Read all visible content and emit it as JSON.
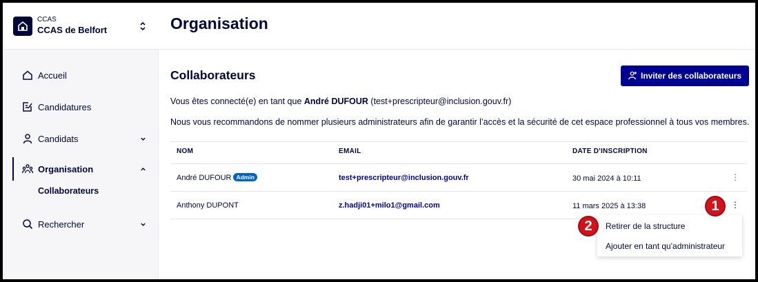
{
  "sidebar": {
    "org_type": "CCAS",
    "org_name": "CCAS de Belfort",
    "items": [
      {
        "label": "Accueil",
        "icon": "home-icon"
      },
      {
        "label": "Candidatures",
        "icon": "document-edit-icon"
      },
      {
        "label": "Candidats",
        "icon": "user-icon"
      },
      {
        "label": "Organisation",
        "icon": "team-icon"
      },
      {
        "label": "Rechercher",
        "icon": "search-icon"
      }
    ],
    "sub_item": "Collaborateurs"
  },
  "header": {
    "title": "Organisation"
  },
  "section": {
    "title": "Collaborateurs",
    "invite_label": "Inviter des collaborateurs",
    "connected_prefix": "Vous êtes connecté(e) en tant que ",
    "connected_name": "André DUFOUR",
    "connected_email": " (test+prescripteur@inclusion.gouv.fr)",
    "recommendation": "Nous vous recommandons de nommer plusieurs administrateurs afin de garantir l’accès et la sécurité de cet espace professionnel à tous vos membres."
  },
  "table": {
    "headers": [
      "NOM",
      "EMAIL",
      "DATE D'INSCRIPTION"
    ],
    "rows": [
      {
        "name": "André DUFOUR",
        "badge": "Admin",
        "email": "test+prescripteur@inclusion.gouv.fr",
        "date": "30 mai 2024 à 10:11"
      },
      {
        "name": "Anthony DUPONT",
        "badge": "",
        "email": "z.hadji01+milo1@gmail.com",
        "date": "11 mars 2025 à 13:38"
      }
    ]
  },
  "menu": {
    "items": [
      "Retirer de la structure",
      "Ajouter en tant qu'administrateur"
    ]
  },
  "steps": [
    "1",
    "2"
  ],
  "colors": {
    "primary": "#000091",
    "dark": "#000638",
    "badge": "#0063cb",
    "step": "#d3121c"
  }
}
